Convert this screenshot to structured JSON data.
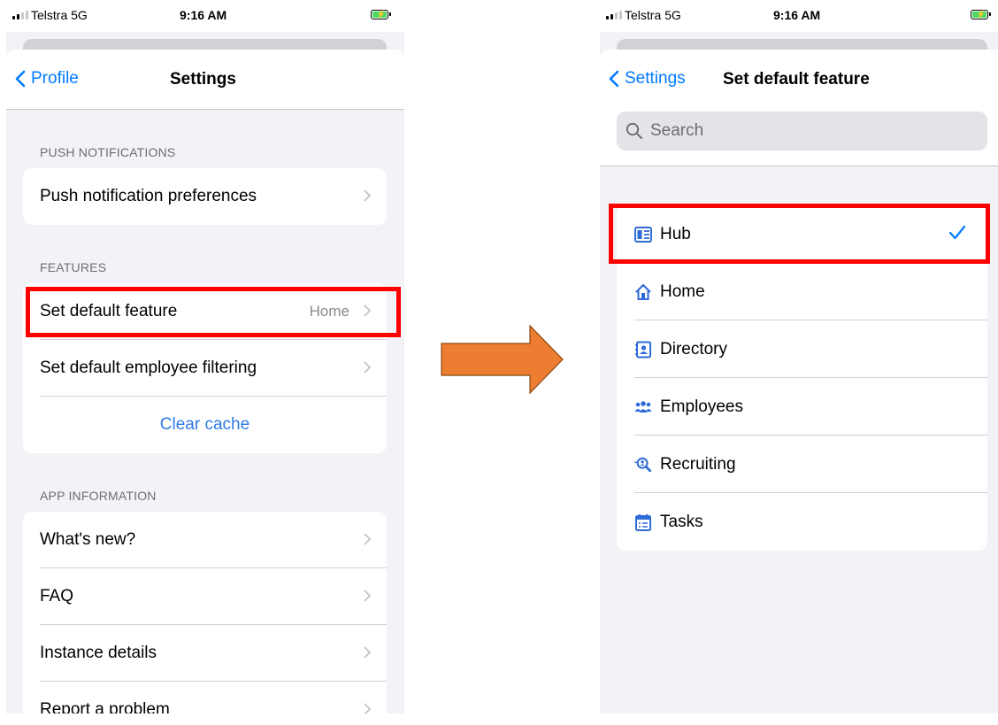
{
  "left_screen": {
    "status": {
      "carrier": "Telstra  5G",
      "time": "9:16 AM"
    },
    "nav": {
      "back_label": "Profile",
      "title": "Settings"
    },
    "sections": {
      "push": {
        "header": "PUSH NOTIFICATIONS",
        "rows": [
          {
            "label": "Push notification preferences"
          }
        ]
      },
      "features": {
        "header": "FEATURES",
        "rows": [
          {
            "label": "Set default feature",
            "value": "Home"
          },
          {
            "label": "Set default employee filtering"
          }
        ],
        "clear_cache": "Clear cache"
      },
      "app_info": {
        "header": "APP INFORMATION",
        "rows": [
          {
            "label": "What's new?"
          },
          {
            "label": "FAQ"
          },
          {
            "label": "Instance details"
          },
          {
            "label": "Report a problem"
          }
        ]
      }
    }
  },
  "right_screen": {
    "status": {
      "carrier": "Telstra  5G",
      "time": "9:16 AM"
    },
    "nav": {
      "back_label": "Settings",
      "title": "Set default feature"
    },
    "search": {
      "placeholder": "Search"
    },
    "features": [
      {
        "label": "Hub",
        "icon": "hub-icon",
        "selected": true
      },
      {
        "label": "Home",
        "icon": "home-icon"
      },
      {
        "label": "Directory",
        "icon": "directory-icon"
      },
      {
        "label": "Employees",
        "icon": "employees-icon"
      },
      {
        "label": "Recruiting",
        "icon": "recruiting-icon"
      },
      {
        "label": "Tasks",
        "icon": "tasks-icon"
      }
    ]
  },
  "colors": {
    "accent": "#007aff",
    "highlight": "#ff0000",
    "arrow": "#ed7d31",
    "battery": "#4cd964"
  }
}
